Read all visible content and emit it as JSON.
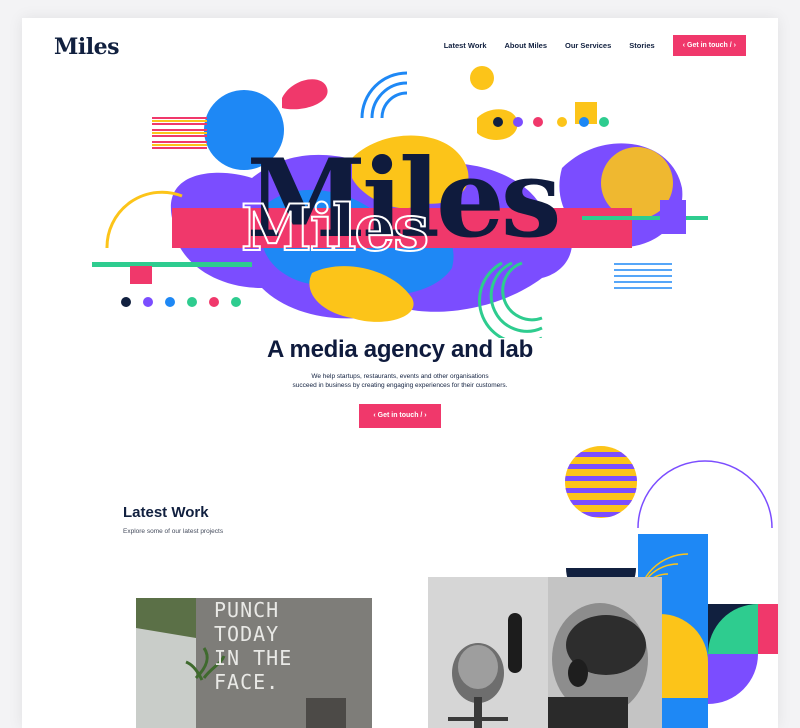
{
  "header": {
    "brand": "Miles",
    "nav": [
      "Latest Work",
      "About Miles",
      "Our Services",
      "Stories"
    ],
    "cta": "‹ Get in touch / ›"
  },
  "hero": {
    "big_title": "Miles",
    "outline_title": "Miles",
    "tagline": "A media agency and lab",
    "description_line1": "We help startups, restaurants, events and other organisations",
    "description_line2": "succeed in business by creating engaging experiences for their customers.",
    "cta": "‹ Get in touch / ›"
  },
  "latest_work": {
    "title": "Latest Work",
    "subtitle": "Explore some of our latest projects",
    "projects": [
      {
        "image_text": [
          "PUNCH",
          "TODAY",
          "IN THE",
          "FACE."
        ]
      },
      {
        "image_text": []
      }
    ]
  },
  "colors": {
    "navy": "#11203f",
    "pink": "#f0386b",
    "blue": "#1e88f5",
    "yellow": "#fcc419",
    "purple": "#7b4dff",
    "green": "#2ecc8f"
  }
}
